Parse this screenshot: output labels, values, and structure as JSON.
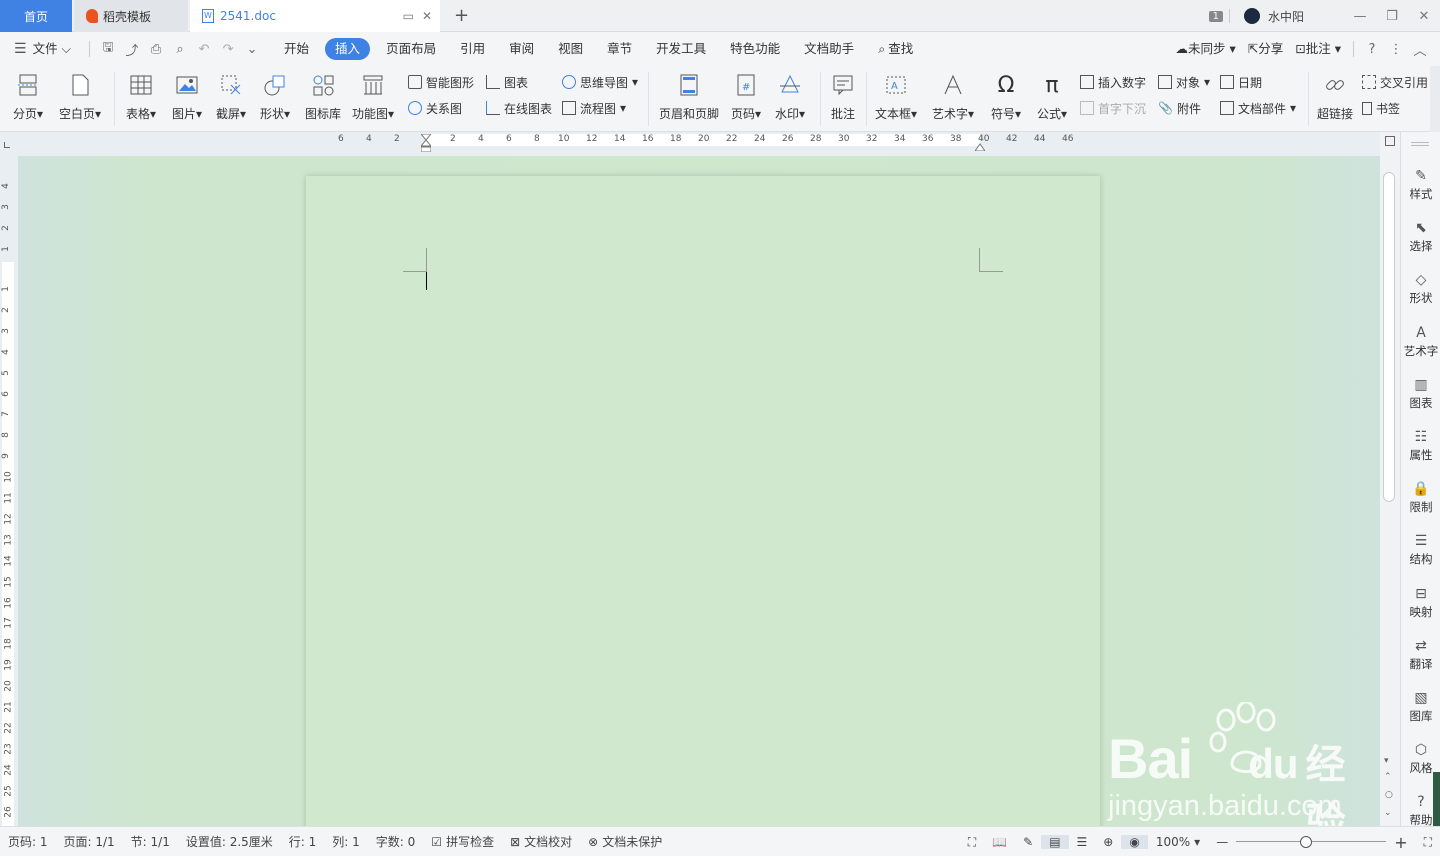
{
  "tabs": {
    "home": "首页",
    "template": "稻壳模板",
    "document": "2541.doc"
  },
  "titlebar": {
    "badge": "1",
    "user": "水中阳"
  },
  "menu": {
    "file": "文件",
    "items": [
      "开始",
      "插入",
      "页面布局",
      "引用",
      "审阅",
      "视图",
      "章节",
      "开发工具",
      "特色功能",
      "文档助手"
    ],
    "active_index": 1,
    "search": "查找",
    "sync": "未同步",
    "share": "分享",
    "comment": "批注",
    "help": "?"
  },
  "ribbon": {
    "big": [
      "分页",
      "空白页",
      "表格",
      "图片",
      "截屏",
      "形状",
      "图标库",
      "功能图",
      "页眉和页脚",
      "页码",
      "水印",
      "批注",
      "文本框",
      "艺术字",
      "符号",
      "公式",
      "超链接"
    ],
    "small": {
      "smart_graphic": "智能图形",
      "chart": "图表",
      "mindmap": "思维导图",
      "relation": "关系图",
      "online_chart": "在线图表",
      "flowchart": "流程图",
      "insert_number": "插入数字",
      "object": "对象",
      "date": "日期",
      "crossref": "交叉引用",
      "dropcap": "首字下沉",
      "attachment": "附件",
      "doc_parts": "文档部件",
      "bookmark": "书签"
    }
  },
  "ruler": {
    "h_left": [
      "6",
      "4",
      "2"
    ],
    "h_right": [
      "2",
      "4",
      "6",
      "8",
      "10",
      "12",
      "14",
      "16",
      "18",
      "20",
      "22",
      "24",
      "26",
      "28",
      "30",
      "32",
      "34",
      "36",
      "38",
      "40",
      "42",
      "44",
      "46"
    ],
    "v_top": [
      "4",
      "3",
      "2",
      "1"
    ],
    "v_main": [
      "1",
      "2",
      "3",
      "4",
      "5",
      "6",
      "7",
      "8",
      "9",
      "10",
      "11",
      "12",
      "13",
      "14",
      "15",
      "16",
      "17",
      "18",
      "19",
      "20",
      "21",
      "22",
      "23",
      "24",
      "25",
      "26"
    ]
  },
  "right_panel": [
    "样式",
    "选择",
    "形状",
    "艺术字",
    "图表",
    "属性",
    "限制",
    "结构",
    "映射",
    "翻译",
    "图库",
    "风格",
    "帮助"
  ],
  "status": {
    "page_num": "页码: 1",
    "pages": "页面: 1/1",
    "section": "节: 1/1",
    "setting": "设置值: 2.5厘米",
    "row": "行: 1",
    "col": "列: 1",
    "words": "字数: 0",
    "spell": "拼写检查",
    "proof": "文档校对",
    "protect": "文档未保护",
    "zoom": "100%"
  },
  "watermark": {
    "brand": "Bai",
    "brand2": "du",
    "cn": "经验",
    "url": "jingyan.baidu.com"
  },
  "colors": {
    "accent": "#3f82e4",
    "page": "#cfe8ce",
    "workspace": "#cde6cd"
  }
}
